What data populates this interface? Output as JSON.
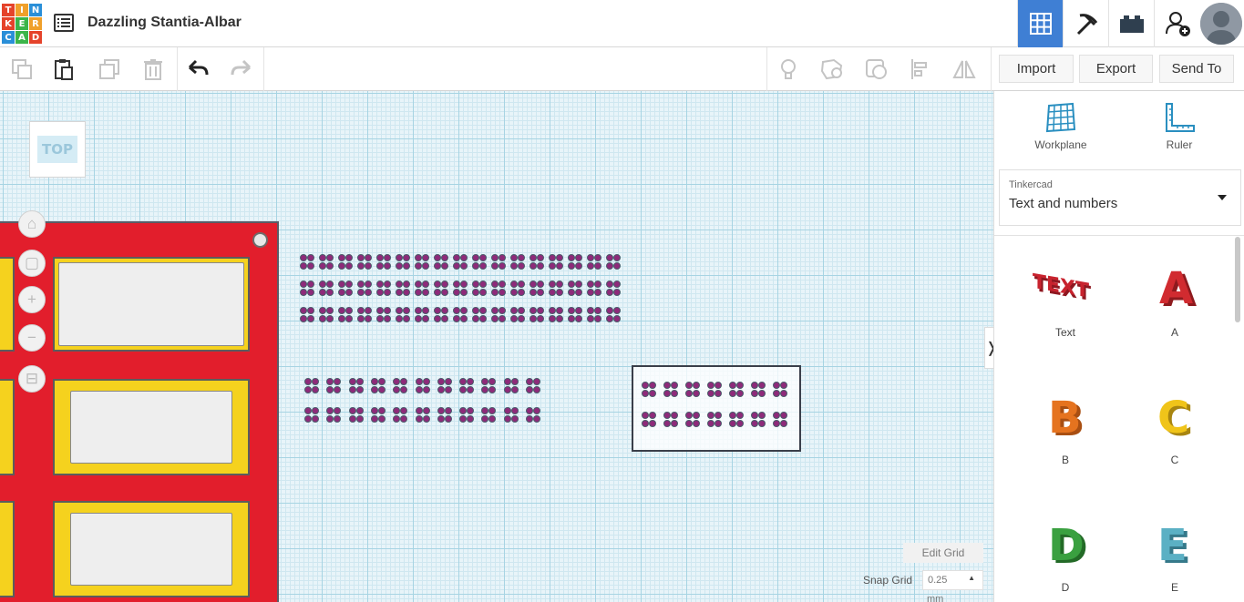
{
  "app": {
    "logo_letters": [
      "T",
      "I",
      "N",
      "K",
      "E",
      "R",
      "C",
      "A",
      "D"
    ],
    "logo_colors": [
      "#e5432b",
      "#f0a02b",
      "#2a8fd8",
      "#e5432b",
      "#3cb54a",
      "#f0a02b",
      "#2a8fd8",
      "#3cb54a",
      "#e5432b"
    ],
    "project_title": "Dazzling Stantia-Albar"
  },
  "header_tabs": [
    {
      "name": "3D design",
      "icon": "grid-icon",
      "active": true
    },
    {
      "name": "Circuits",
      "icon": "pickaxe-icon",
      "active": false
    },
    {
      "name": "Bricks",
      "icon": "brick-icon",
      "active": false
    },
    {
      "name": "Invite",
      "icon": "add-user-icon",
      "active": false
    }
  ],
  "toolbar": {
    "left_icons": [
      "copy-icon",
      "paste-icon",
      "duplicate-icon",
      "delete-icon",
      "undo-icon",
      "redo-icon"
    ],
    "right_icons": [
      "lightbulb-icon",
      "shape-icon",
      "hole-icon",
      "align-icon",
      "mirror-icon"
    ],
    "import_label": "Import",
    "export_label": "Export",
    "send_to_label": "Send To"
  },
  "canvas": {
    "view_cube_label": "TOP",
    "nav_icons": [
      "home-icon",
      "fit-icon",
      "zoom-in-icon",
      "zoom-out-icon",
      "perspective-icon"
    ],
    "edit_grid_label": "Edit Grid",
    "snap_grid_label": "Snap Grid",
    "snap_grid_value": "0.25",
    "snap_grid_unit": "mm",
    "colors": {
      "plate": "#e21e2c",
      "frame": "#f5d21e",
      "pads": "#8e2a7a",
      "grid": "#a7d4e3"
    }
  },
  "panel": {
    "workplane_label": "Workplane",
    "ruler_label": "Ruler",
    "library_source": "Tinkercad",
    "library_category": "Text and numbers",
    "shapes": [
      {
        "label": "Text",
        "color": "#c8232e"
      },
      {
        "label": "A",
        "color": "#d12b30"
      },
      {
        "label": "B",
        "color": "#e5731f"
      },
      {
        "label": "C",
        "color": "#f0c419"
      },
      {
        "label": "D",
        "color": "#3aa040"
      },
      {
        "label": "E",
        "color": "#5bb0c4"
      }
    ]
  }
}
